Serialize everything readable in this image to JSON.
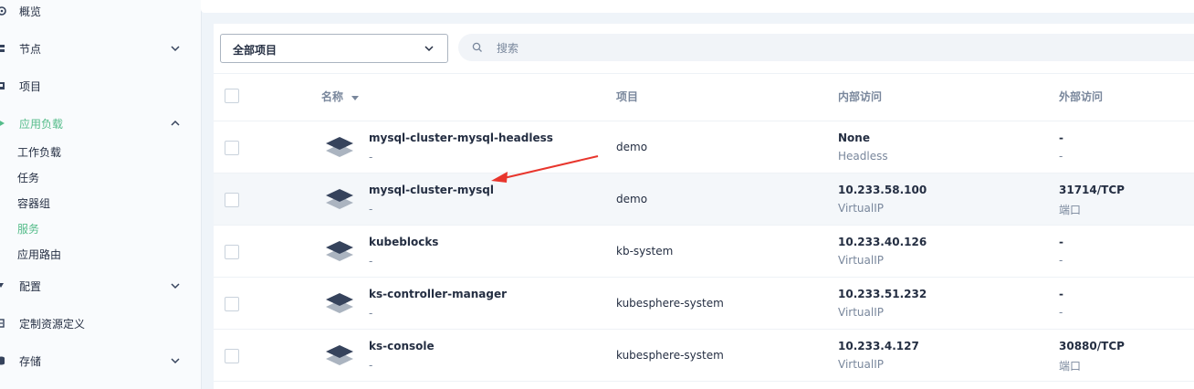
{
  "sidebar": {
    "items": [
      {
        "label": "概览",
        "icon": "dashboard-icon"
      },
      {
        "label": "节点",
        "icon": "server-icon"
      },
      {
        "label": "项目",
        "icon": "project-icon"
      },
      {
        "label": "应用负载",
        "icon": "appworkload-icon"
      },
      {
        "label": "配置",
        "icon": "config-icon"
      },
      {
        "label": "定制资源定义",
        "icon": "crd-icon"
      },
      {
        "label": "存储",
        "icon": "storage-icon"
      }
    ],
    "workload_sub": [
      {
        "label": "工作负载"
      },
      {
        "label": "任务"
      },
      {
        "label": "容器组"
      },
      {
        "label": "服务"
      },
      {
        "label": "应用路由"
      }
    ],
    "active_item": "应用负载",
    "active_sub": "服务"
  },
  "toolbar": {
    "project_select": "全部项目",
    "search_placeholder": "搜索"
  },
  "table": {
    "headers": {
      "name": "名称",
      "project": "项目",
      "internal": "内部访问",
      "external": "外部访问"
    },
    "rows": [
      {
        "name": "mysql-cluster-mysql-headless",
        "desc": "-",
        "project": "demo",
        "internal": "None",
        "internal_type": "Headless",
        "external": "-",
        "external_type": "-"
      },
      {
        "name": "mysql-cluster-mysql",
        "desc": "-",
        "project": "demo",
        "internal": "10.233.58.100",
        "internal_type": "VirtualIP",
        "external": "31714/TCP",
        "external_type": "端口"
      },
      {
        "name": "kubeblocks",
        "desc": "-",
        "project": "kb-system",
        "internal": "10.233.40.126",
        "internal_type": "VirtualIP",
        "external": "-",
        "external_type": "-"
      },
      {
        "name": "ks-controller-manager",
        "desc": "-",
        "project": "kubesphere-system",
        "internal": "10.233.51.232",
        "internal_type": "VirtualIP",
        "external": "-",
        "external_type": "-"
      },
      {
        "name": "ks-console",
        "desc": "-",
        "project": "kubesphere-system",
        "internal": "10.233.4.127",
        "internal_type": "VirtualIP",
        "external": "30880/TCP",
        "external_type": "端口"
      }
    ]
  },
  "colors": {
    "accent": "#55bc8a",
    "annotation_arrow": "#e8362d",
    "text": "#242e42",
    "muted": "#79879c"
  }
}
